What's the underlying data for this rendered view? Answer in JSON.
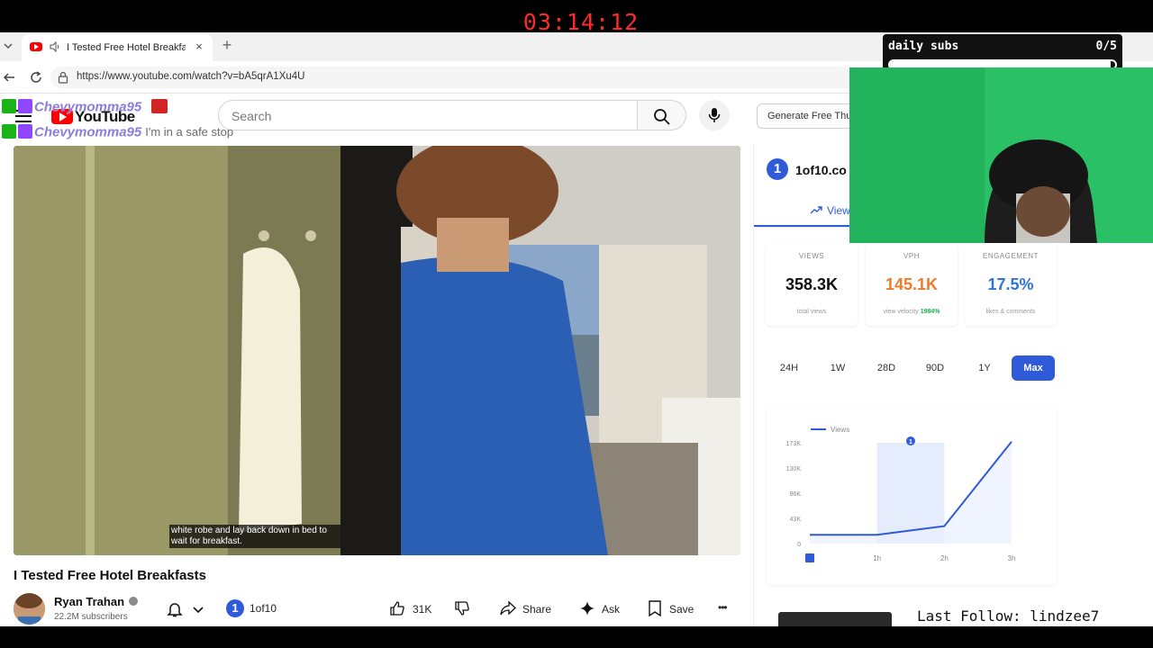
{
  "timer": "03:14:12",
  "browser": {
    "tab_title": "I Tested Free Hotel Breakfasts",
    "tab_close": "×",
    "new_tab": "+",
    "url": "https://www.youtube.com/watch?v=bA5qrA1Xu4U"
  },
  "youtube": {
    "logo": "YouTube",
    "search_placeholder": "Search",
    "generate_button": "Generate Free Thu"
  },
  "chat": [
    {
      "name": "Chevymomma95",
      "message": ""
    },
    {
      "name": "Chevymomma95",
      "message": "I'm in a safe stop"
    }
  ],
  "video": {
    "caption": "white robe and lay back down in bed to wait for breakfast.",
    "title": "I Tested Free Hotel Breakfasts",
    "channel": "Ryan Trahan",
    "subscribers": "22.2M subscribers",
    "one_badge": "1",
    "one_label": "1of10",
    "likes": "31K",
    "share": "Share",
    "ask": "Ask",
    "save": "Save",
    "more": "•••"
  },
  "panel": {
    "badge": "1",
    "name": "1of10.co",
    "tab": "View",
    "stats": [
      {
        "label": "VIEWS",
        "value": "358.3K",
        "sub": "total views",
        "color": "#111111"
      },
      {
        "label": "VPH",
        "value": "145.1K",
        "sub": "view velocity",
        "sub_highlight": "1984%",
        "color": "#f07a2a"
      },
      {
        "label": "ENGAGEMENT",
        "value": "17.5%",
        "sub": "likes & comments",
        "color": "#2f74d8"
      }
    ],
    "ranges": [
      "24H",
      "1W",
      "28D",
      "90D",
      "1Y",
      "Max"
    ],
    "active_range": "Max"
  },
  "chart_data": {
    "type": "line",
    "legend": "Views",
    "x": [
      "0",
      "1h",
      "2h",
      "3h"
    ],
    "y_ticks": [
      "0",
      "43K",
      "86K",
      "130K",
      "173K"
    ],
    "ylim": [
      0,
      173000
    ],
    "series": [
      {
        "name": "Views",
        "values": [
          15000,
          15000,
          30000,
          175000
        ],
        "color": "#2f5ad8"
      }
    ],
    "highlight_x_range": [
      "1h",
      "2h"
    ],
    "marker_label": "1"
  },
  "overlay": {
    "subs_title": "daily subs",
    "subs_count": "0/5",
    "subs_progress": 0.98,
    "last_follow": "Last Follow: lindzee7"
  },
  "colors": {
    "accent": "#2f5ad8",
    "yt_red": "#ff0000",
    "timer_red": "#ff2a2a",
    "green_screen": "#29c066"
  }
}
